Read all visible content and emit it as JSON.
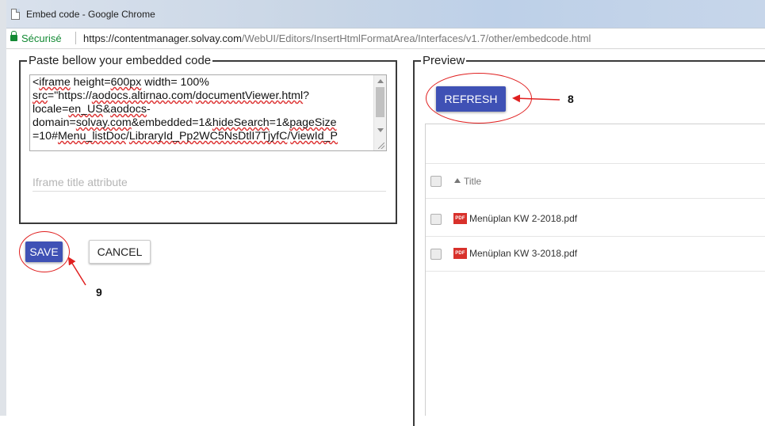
{
  "window": {
    "title": "Embed code - Google Chrome"
  },
  "address_bar": {
    "secure_label": "Sécurisé",
    "url_origin": "https://contentmanager.solvay.com",
    "url_path": "/WebUI/Editors/InsertHtmlFormatArea/Interfaces/v1.7/other/embedcode.html"
  },
  "embed_panel": {
    "legend": "Paste bellow your embedded code",
    "code_segments": [
      {
        "text": "<",
        "squiggle": false
      },
      {
        "text": "iframe",
        "squiggle": true
      },
      {
        "text": " height=",
        "squiggle": false
      },
      {
        "text": "600px",
        "squiggle": true
      },
      {
        "text": " width= 100%\n",
        "squiggle": false
      },
      {
        "text": "src",
        "squiggle": true
      },
      {
        "text": "=\"https://",
        "squiggle": false
      },
      {
        "text": "aodocs.altirnao.com",
        "squiggle": true
      },
      {
        "text": "/",
        "squiggle": false
      },
      {
        "text": "documentViewer.html",
        "squiggle": true
      },
      {
        "text": "?\nlocale=",
        "squiggle": false
      },
      {
        "text": "en_US",
        "squiggle": true
      },
      {
        "text": "&",
        "squiggle": false
      },
      {
        "text": "aodocs",
        "squiggle": true
      },
      {
        "text": "-\ndomain=",
        "squiggle": false
      },
      {
        "text": "solvay.com",
        "squiggle": true
      },
      {
        "text": "&embedded=1&",
        "squiggle": false
      },
      {
        "text": "hideSearch",
        "squiggle": true
      },
      {
        "text": "=1&",
        "squiggle": false
      },
      {
        "text": "pageSize",
        "squiggle": true
      },
      {
        "text": "\n=10#",
        "squiggle": false
      },
      {
        "text": "Menu_listDoc",
        "squiggle": true
      },
      {
        "text": "/",
        "squiggle": false
      },
      {
        "text": "LibraryId_Pp2WC5NsDtlI7TjyfC",
        "squiggle": true
      },
      {
        "text": "/",
        "squiggle": false
      },
      {
        "text": "ViewId_P",
        "squiggle": true
      },
      {
        "text": "\n...",
        "squiggle": false
      }
    ],
    "iframe_title_placeholder": "Iframe title attribute",
    "save_label": "SAVE",
    "cancel_label": "CANCEL"
  },
  "preview_panel": {
    "legend": "Preview",
    "refresh_label": "REFRESH",
    "table": {
      "column_title": "Title",
      "rows": [
        {
          "name": "Menüplan KW 2-2018.pdf",
          "icon": "pdf-icon"
        },
        {
          "name": "Menüplan KW 3-2018.pdf",
          "icon": "pdf-icon"
        }
      ]
    }
  },
  "annotations": {
    "refresh_marker": "8",
    "save_marker": "9",
    "color": "#e02020"
  },
  "colors": {
    "primary_button": "#3f51b5",
    "secure_green": "#138a34",
    "pdf_red": "#d8312b"
  }
}
